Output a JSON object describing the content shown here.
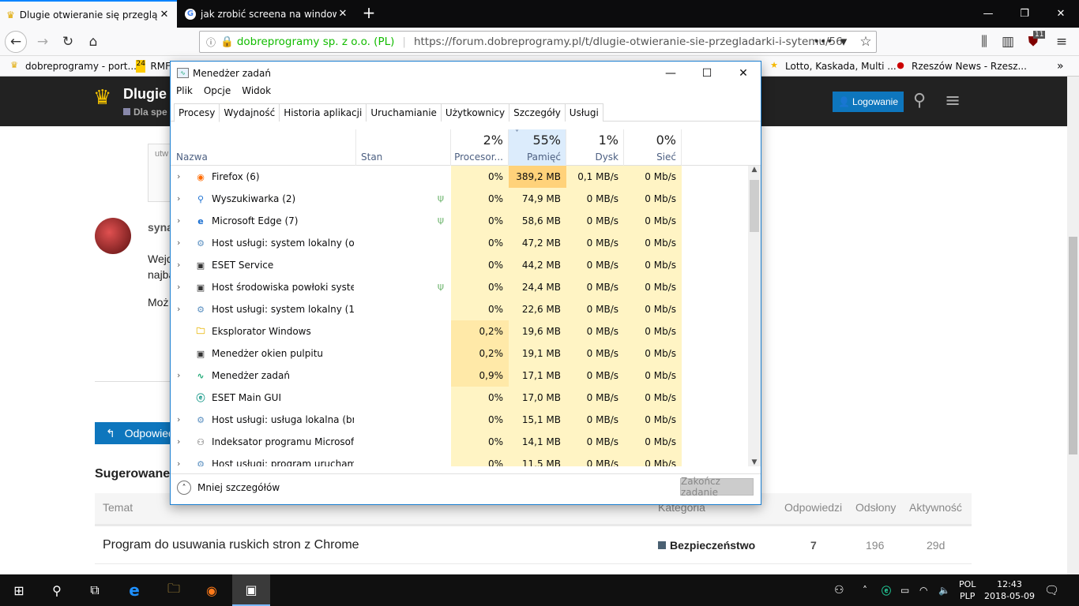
{
  "browser": {
    "tabs": [
      {
        "title": "Dlugie otwieranie się przeglądarki",
        "active": true
      },
      {
        "title": "jak zrobić screena na windows",
        "active": false
      }
    ],
    "new_tab_label": "+",
    "urlbar": {
      "site_identity": "dobreprogramy sp. z o.o. (PL)",
      "url": "https://forum.dobreprogramy.pl/t/dlugie-otwieranie-sie-przegladarki-i-sytemu/56"
    },
    "toolbar_badge": "11",
    "bookmarks": [
      {
        "label": "dobreprogramy - port..."
      },
      {
        "label": "RMF"
      },
      {
        "label": "Lotto, Kaskada, Multi ..."
      },
      {
        "label": "Rzeszów News - Rzesz..."
      }
    ]
  },
  "page": {
    "header_title": "Dlugie",
    "header_subtitle": "Dla spe",
    "login_label": "Logowanie",
    "post_author": "syna",
    "post_lines": [
      "Wejd",
      "najba",
      "Moż"
    ],
    "quote_fragment": "utw",
    "reply_label": "Odpowied",
    "suggested_heading": "Sugerowane",
    "table_headers": [
      "Temat",
      "Kategoria",
      "Odpowiedzi",
      "Odsłony",
      "Aktywność"
    ],
    "table_rows": [
      {
        "topic": "Program do usuwania ruskich stron z Chrome",
        "category": "Bezpieczeństwo",
        "replies": "7",
        "views": "196",
        "activity": "29d"
      }
    ]
  },
  "taskmgr": {
    "title": "Menedżer zadań",
    "menu": [
      "Plik",
      "Opcje",
      "Widok"
    ],
    "tabs": [
      "Procesy",
      "Wydajność",
      "Historia aplikacji",
      "Uruchamianie",
      "Użytkownicy",
      "Szczegóły",
      "Usługi"
    ],
    "columns": {
      "name": "Nazwa",
      "status": "Stan",
      "cpu": {
        "label": "Procesor...",
        "pct": "2%"
      },
      "memory": {
        "label": "Pamięć",
        "pct": "55%"
      },
      "disk": {
        "label": "Dysk",
        "pct": "1%"
      },
      "network": {
        "label": "Sieć",
        "pct": "0%"
      }
    },
    "processes": [
      {
        "name": "Firefox (6)",
        "cpu": "0%",
        "mem": "389,2 MB",
        "disk": "0,1 MB/s",
        "net": "0 Mb/s",
        "expandable": true,
        "suspended": false,
        "icon": "firefox-icon"
      },
      {
        "name": "Wyszukiwarka (2)",
        "cpu": "0%",
        "mem": "74,9 MB",
        "disk": "0 MB/s",
        "net": "0 Mb/s",
        "expandable": true,
        "suspended": true,
        "icon": "search-icon"
      },
      {
        "name": "Microsoft Edge (7)",
        "cpu": "0%",
        "mem": "58,6 MB",
        "disk": "0 MB/s",
        "net": "0 Mb/s",
        "expandable": true,
        "suspended": true,
        "icon": "edge-icon"
      },
      {
        "name": "Host usługi: system lokalny (ogr...",
        "cpu": "0%",
        "mem": "47,2 MB",
        "disk": "0 MB/s",
        "net": "0 Mb/s",
        "expandable": true,
        "suspended": false,
        "icon": "gear-icon"
      },
      {
        "name": "ESET Service",
        "cpu": "0%",
        "mem": "44,2 MB",
        "disk": "0 MB/s",
        "net": "0 Mb/s",
        "expandable": true,
        "suspended": false,
        "icon": "window-icon"
      },
      {
        "name": "Host środowiska powłoki syste...",
        "cpu": "0%",
        "mem": "24,4 MB",
        "disk": "0 MB/s",
        "net": "0 Mb/s",
        "expandable": true,
        "suspended": true,
        "icon": "window-icon"
      },
      {
        "name": "Host usługi: system lokalny (17)",
        "cpu": "0%",
        "mem": "22,6 MB",
        "disk": "0 MB/s",
        "net": "0 Mb/s",
        "expandable": true,
        "suspended": false,
        "icon": "gear-icon"
      },
      {
        "name": "Eksplorator Windows",
        "cpu": "0,2%",
        "mem": "19,6 MB",
        "disk": "0 MB/s",
        "net": "0 Mb/s",
        "expandable": false,
        "suspended": false,
        "icon": "folder-icon"
      },
      {
        "name": "Menedżer okien pulpitu",
        "cpu": "0,2%",
        "mem": "19,1 MB",
        "disk": "0 MB/s",
        "net": "0 Mb/s",
        "expandable": false,
        "suspended": false,
        "icon": "window-icon"
      },
      {
        "name": "Menedżer zadań",
        "cpu": "0,9%",
        "mem": "17,1 MB",
        "disk": "0 MB/s",
        "net": "0 Mb/s",
        "expandable": true,
        "suspended": false,
        "icon": "taskmgr-icon"
      },
      {
        "name": "ESET Main GUI",
        "cpu": "0%",
        "mem": "17,0 MB",
        "disk": "0 MB/s",
        "net": "0 Mb/s",
        "expandable": false,
        "suspended": false,
        "icon": "eset-icon"
      },
      {
        "name": "Host usługi: usługa lokalna (bra...",
        "cpu": "0%",
        "mem": "15,1 MB",
        "disk": "0 MB/s",
        "net": "0 Mb/s",
        "expandable": true,
        "suspended": false,
        "icon": "gear-icon"
      },
      {
        "name": "Indeksator programu Microsoft ...",
        "cpu": "0%",
        "mem": "14,1 MB",
        "disk": "0 MB/s",
        "net": "0 Mb/s",
        "expandable": true,
        "suspended": false,
        "icon": "user-search-icon"
      },
      {
        "name": "Host usługi: program uruchami...",
        "cpu": "0%",
        "mem": "11,5 MB",
        "disk": "0 MB/s",
        "net": "0 Mb/s",
        "expandable": true,
        "suspended": false,
        "icon": "gear-icon"
      }
    ],
    "less_details_label": "Mniej szczegółów",
    "end_task_label": "Zakończ zadanie"
  },
  "taskbar": {
    "lang_line1": "POL",
    "lang_line2": "PLP",
    "time": "12:43",
    "date": "2018-05-09"
  }
}
